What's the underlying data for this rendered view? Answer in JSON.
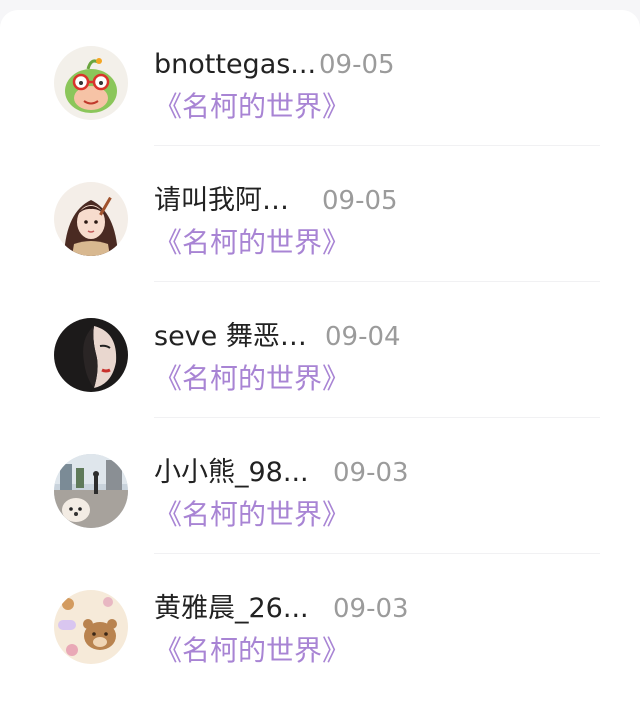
{
  "comments": [
    {
      "username": "bnottegas...",
      "date": "09-05",
      "album": "《名柯的世界》",
      "avatar_icon": "cartoon-frog-with-glasses-avatar"
    },
    {
      "username": "请叫我阿…",
      "date": "09-05",
      "album": "《名柯的世界》",
      "avatar_icon": "anime-girl-avatar"
    },
    {
      "username": "seve 舞恶…",
      "date": "09-04",
      "album": "《名柯的世界》",
      "avatar_icon": "dark-portrait-avatar"
    },
    {
      "username": "小小熊_98...",
      "date": "09-03",
      "album": "《名柯的世界》",
      "avatar_icon": "street-with-dog-avatar"
    },
    {
      "username": "黄雅晨_26...",
      "date": "09-03",
      "album": "《名柯的世界》",
      "avatar_icon": "bear-pattern-avatar"
    }
  ],
  "colors": {
    "album_link": "#a884d4",
    "username": "#222222",
    "date": "#9b9b9b"
  }
}
